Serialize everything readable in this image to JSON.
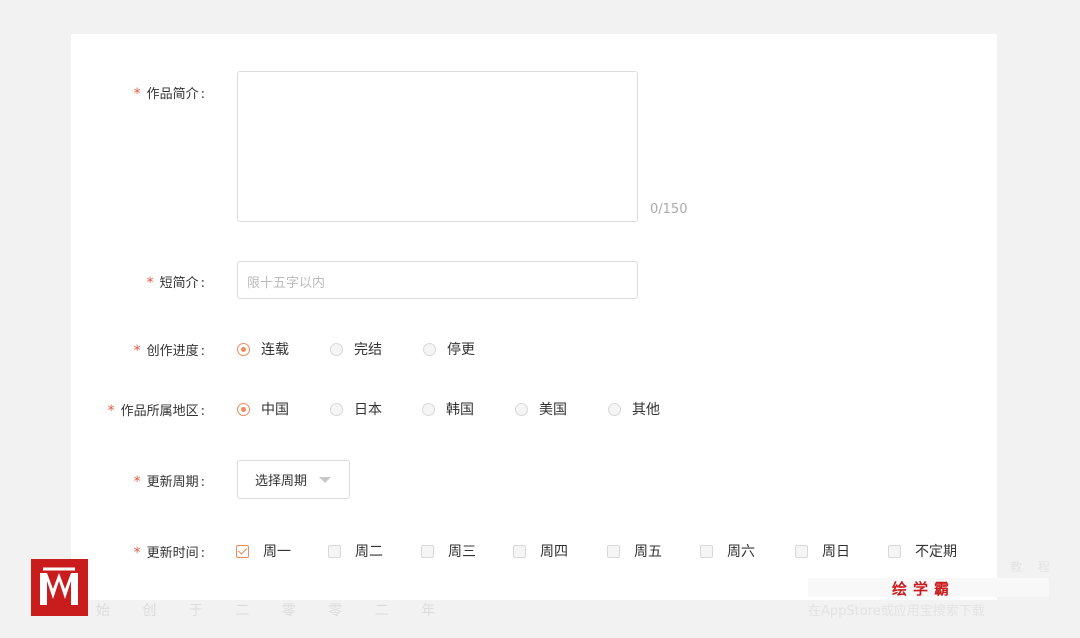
{
  "form": {
    "intro_label": "作品简介",
    "intro_counter": "0/150",
    "short_label": "短简介",
    "short_placeholder": "限十五字以内",
    "progress_label": "创作进度",
    "progress_options": [
      "连载",
      "完结",
      "停更"
    ],
    "progress_selected": "连载",
    "region_label": "作品所属地区",
    "region_options": [
      "中国",
      "日本",
      "韩国",
      "美国",
      "其他"
    ],
    "region_selected": "中国",
    "cycle_label": "更新周期",
    "cycle_select": "选择周期",
    "time_label": "更新时间",
    "time_options": [
      "周一",
      "周二",
      "周三",
      "周四",
      "周五",
      "周六",
      "周日",
      "不定期"
    ],
    "time_checked": [
      "周一"
    ],
    "required_mark": "*",
    "colon": ":"
  },
  "watermark": {
    "bottom_left": "始 创 于 二 零 零 二 年",
    "brand": "绘学霸",
    "top_right": "教 程",
    "bottom_right": "在AppStore或应用宝搜索下载"
  },
  "colors": {
    "accent": "#f08a5d",
    "required": "#e8563a",
    "brand": "#c91d1d"
  }
}
